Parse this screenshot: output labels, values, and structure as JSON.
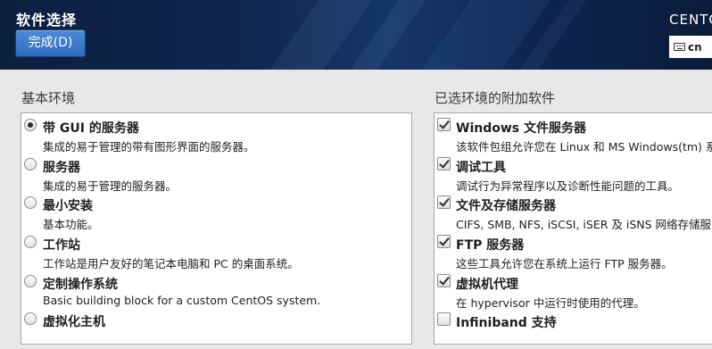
{
  "header": {
    "title": "软件选择",
    "done_label": "完成(D)",
    "product": "CENTOS",
    "keyboard_layout": "cn"
  },
  "base_env": {
    "title": "基本环境",
    "items": [
      {
        "name": "带 GUI 的服务器",
        "desc": "集成的易于管理的带有图形界面的服务器。",
        "selected": true
      },
      {
        "name": "服务器",
        "desc": "集成的易于管理的服务器。",
        "selected": false
      },
      {
        "name": "最小安装",
        "desc": "基本功能。",
        "selected": false
      },
      {
        "name": "工作站",
        "desc": "工作站是用户友好的笔记本电脑和 PC 的桌面系统。",
        "selected": false
      },
      {
        "name": "定制操作系统",
        "desc": "Basic building block for a custom CentOS system.",
        "selected": false
      },
      {
        "name": "虚拟化主机",
        "desc": "",
        "selected": false
      }
    ]
  },
  "addons": {
    "title": "已选环境的附加软件",
    "items": [
      {
        "name": "Windows 文件服务器",
        "desc": "该软件包组允许您在 Linux 和 MS Windows(tm) 系",
        "checked": true
      },
      {
        "name": "调试工具",
        "desc": "调试行为异常程序以及诊断性能问题的工具。",
        "checked": true
      },
      {
        "name": "文件及存储服务器",
        "desc": "CIFS, SMB, NFS, iSCSI, iSER 及 iSNS 网络存储服",
        "checked": true
      },
      {
        "name": "FTP 服务器",
        "desc": "这些工具允许您在系统上运行 FTP 服务器。",
        "checked": true
      },
      {
        "name": "虚拟机代理",
        "desc": "在 hypervisor 中运行时使用的代理。",
        "checked": true
      },
      {
        "name": "Infiniband 支持",
        "desc": "",
        "checked": false
      }
    ]
  }
}
